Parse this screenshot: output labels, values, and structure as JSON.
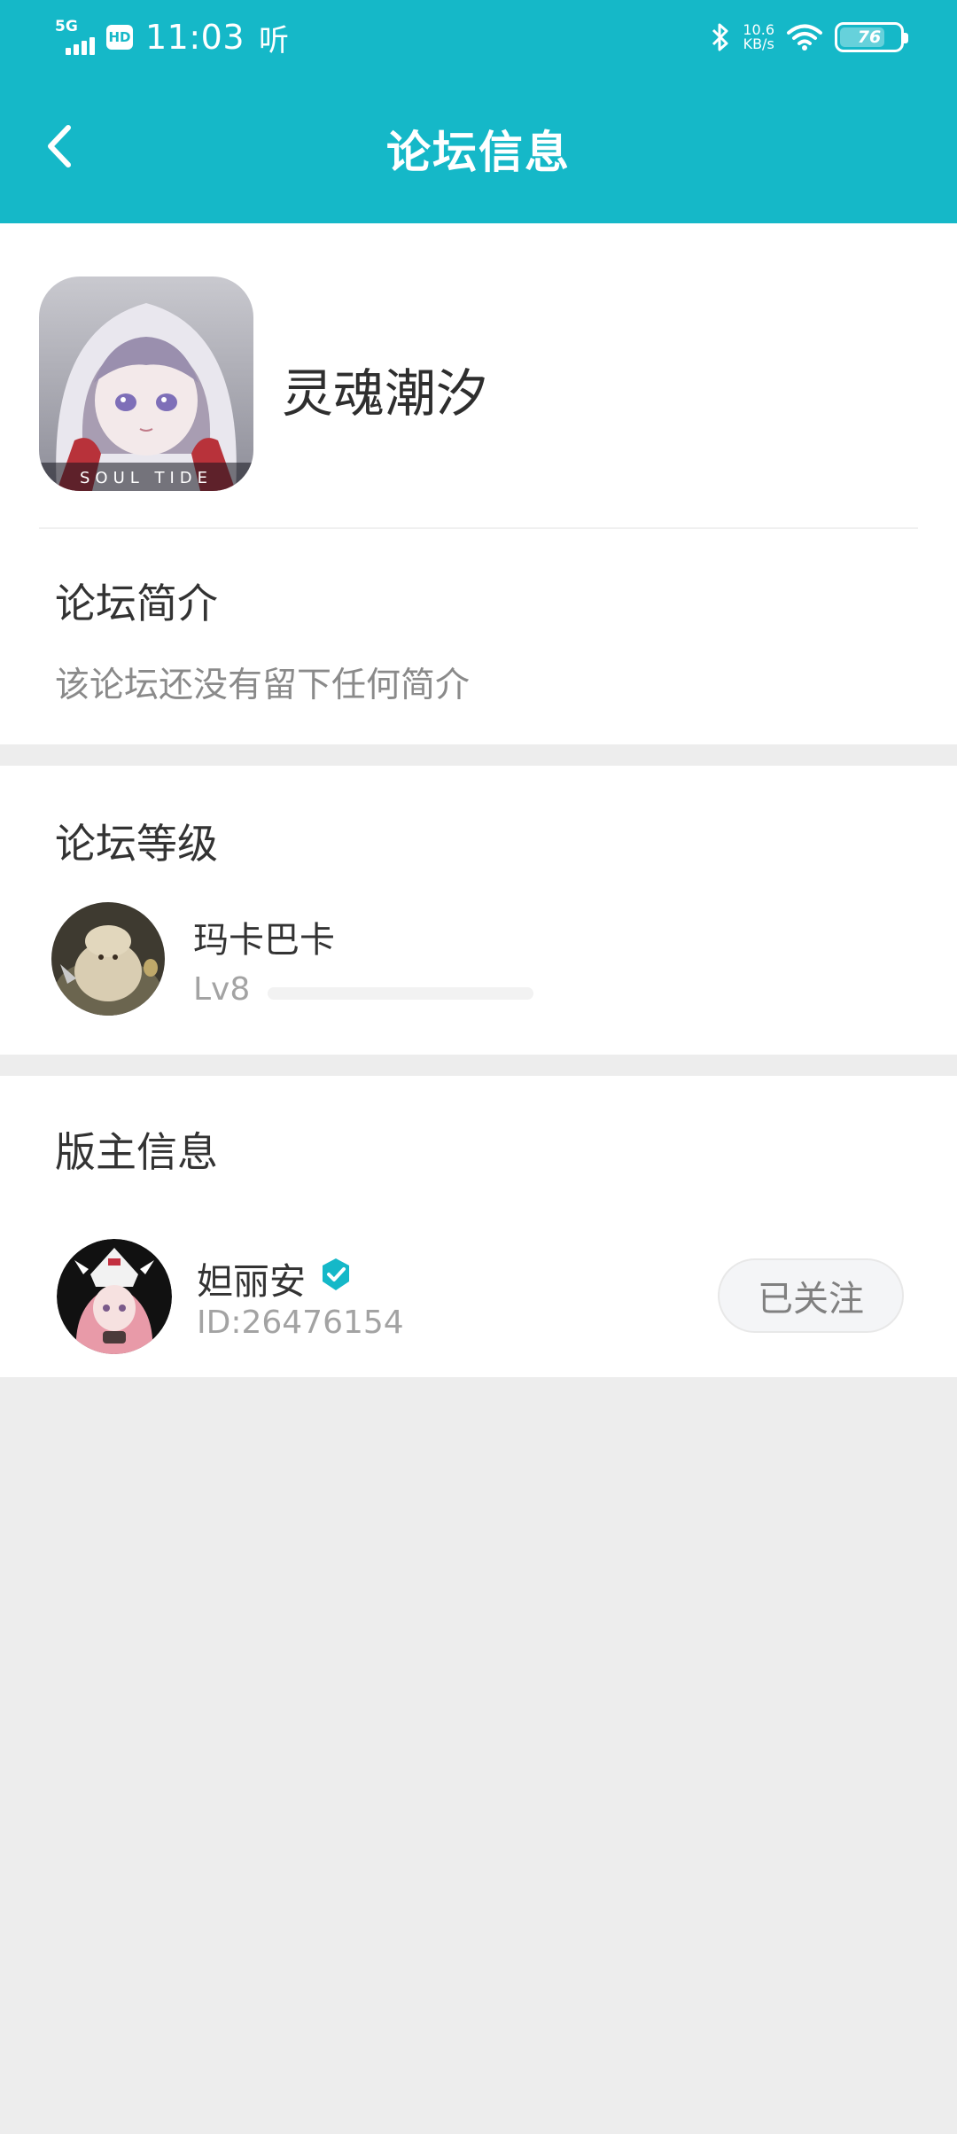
{
  "status_bar": {
    "network": "5G",
    "hd": "HD",
    "time": "11:03",
    "extra_glyph": "听",
    "net_speed_value": "10.6",
    "net_speed_unit": "KB/s",
    "battery": "76",
    "battery_level": 0.76,
    "icons": [
      "signal-icon",
      "bluetooth-icon",
      "wifi-icon",
      "battery-icon"
    ]
  },
  "nav": {
    "title": "论坛信息",
    "back_icon": "chevron-left-icon"
  },
  "forum": {
    "name": "灵魂潮汐",
    "logo_text": "SOUL TIDE",
    "intro_title": "论坛简介",
    "intro_text": "该论坛还没有留下任何简介"
  },
  "level": {
    "title": "论坛等级",
    "name": "玛卡巴卡",
    "lv": "Lv8",
    "progress": 0.0
  },
  "moderator": {
    "title": "版主信息",
    "name": "妲丽安",
    "id": "ID:26476154",
    "follow_label": "已关注",
    "verified_icon": "verified-badge-icon"
  },
  "colors": {
    "accent": "#15b8c8",
    "background": "#ededed",
    "card": "#ffffff",
    "muted_text": "#8a8a8a"
  }
}
